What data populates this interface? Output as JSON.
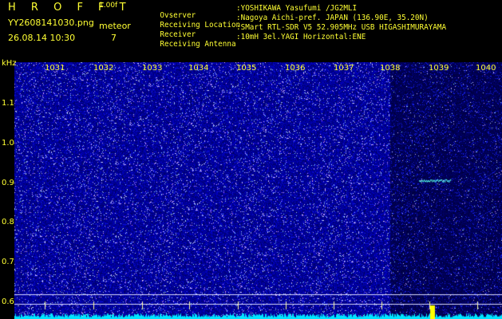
{
  "header": {
    "logo": "H R O F F T",
    "version": "1.00f",
    "filename": "YY2608141030.png",
    "datetime": "26.08.14 10:30",
    "meteor_label": "meteor",
    "meteor_count": "7"
  },
  "station": [
    {
      "label": "Ovserver",
      "value": ":YOSHIKAWA Yasufumi /JG2MLI"
    },
    {
      "label": "Receiving Location",
      "value": ":Nagoya Aichi-pref. JAPAN (136.90E, 35.20N)"
    },
    {
      "label": "Receiver",
      "value": ":SMart RTL-SDR V5 52.905MHz USB HIGASHIMURAYAMA"
    },
    {
      "label": "Receiving Antenna",
      "value": ":10mH 3el.YAGI Horizontal:ENE"
    }
  ],
  "axis": {
    "y_unit": "kHz",
    "x_ticks": [
      "1031",
      "1032",
      "1033",
      "1034",
      "1035",
      "1036",
      "1037",
      "1038",
      "1039",
      "1040"
    ],
    "y_ticks": [
      "1.1",
      "1.0",
      "0.9",
      "0.8",
      "0.7",
      "0.6"
    ]
  },
  "colors": {
    "text": "#ffff33",
    "noise": "#1a20b8",
    "signal": "#00e5ff",
    "baseline_line": "#ffffff",
    "marker": "#ffff00"
  },
  "meteor_echo": {
    "x_minute": 1039.0,
    "freq_khz": 0.915
  }
}
